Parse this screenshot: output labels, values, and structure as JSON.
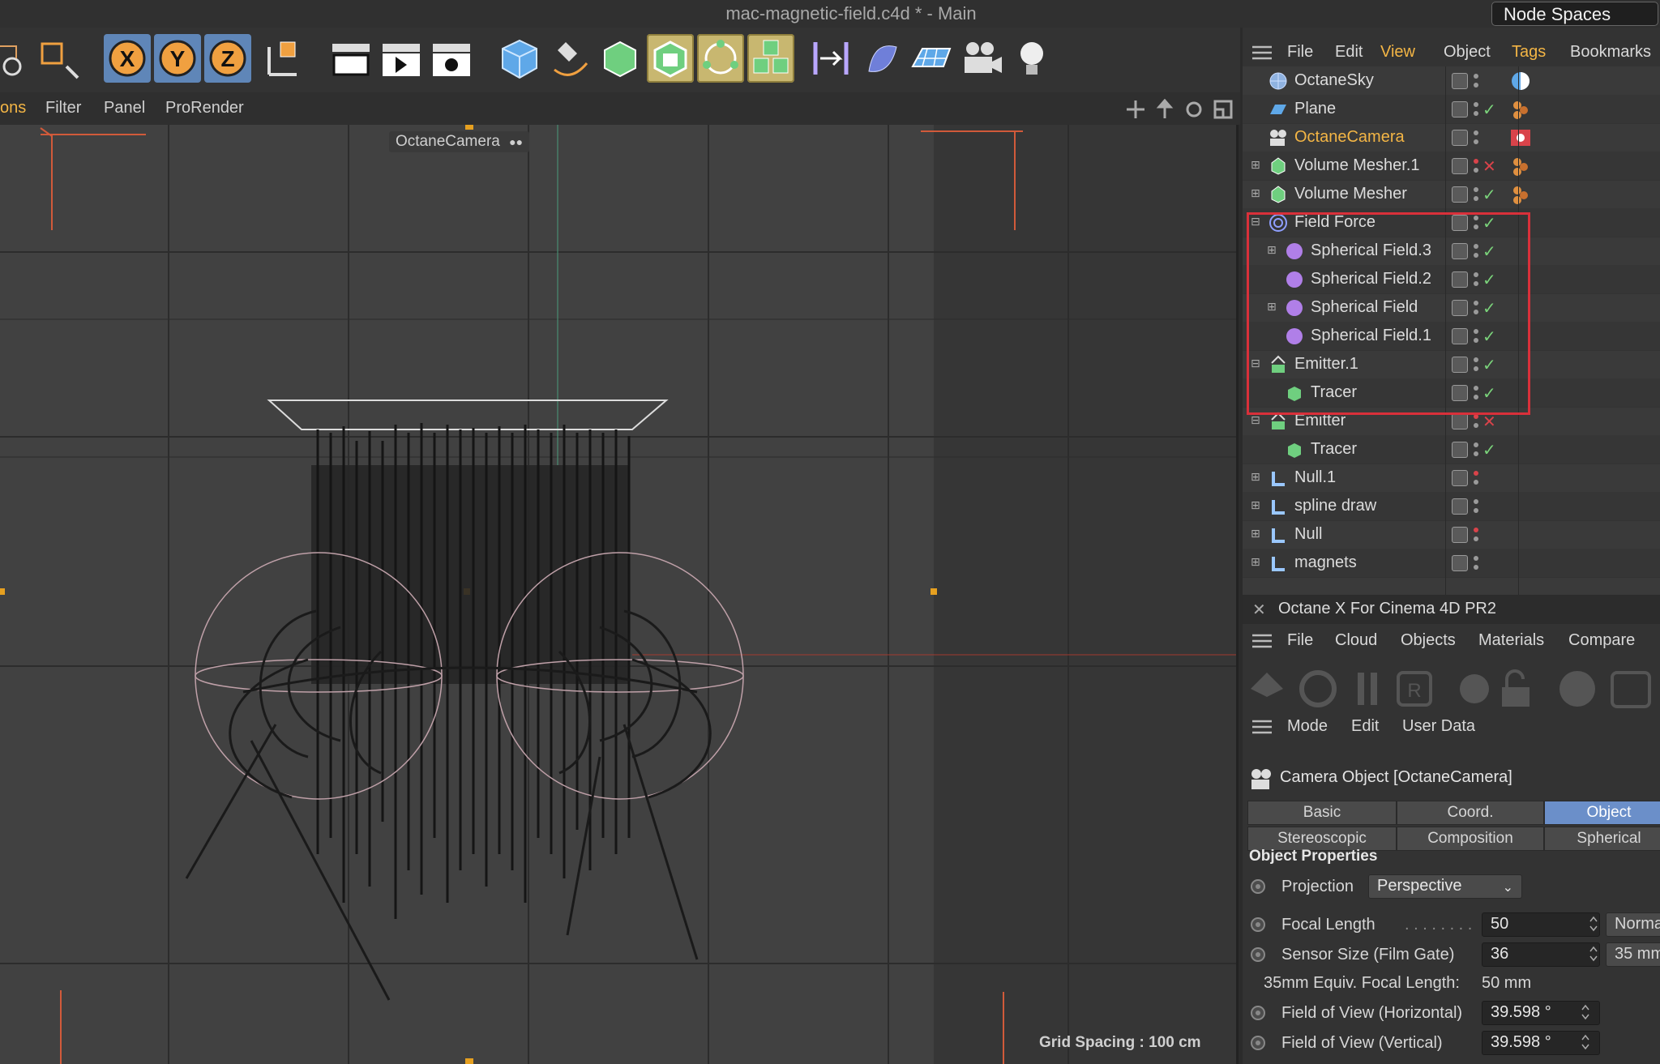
{
  "window": {
    "title": "mac-magnetic-field.c4d * - Main",
    "node_spaces": "Node Spaces"
  },
  "viewport": {
    "menu": [
      "ons",
      "Filter",
      "Panel",
      "ProRender"
    ],
    "camera_label": "OctaneCamera",
    "grid_spacing": "Grid Spacing : 100 cm"
  },
  "object_manager": {
    "menu": [
      "File",
      "Edit",
      "View",
      "Object",
      "Tags",
      "Bookmarks"
    ],
    "objects": [
      {
        "name": "OctaneSky",
        "icon": "sky-icon",
        "status": ""
      },
      {
        "name": "Plane",
        "icon": "plane-icon",
        "status": "check"
      },
      {
        "name": "OctaneCamera",
        "icon": "camera-icon",
        "status": "",
        "active": true
      },
      {
        "name": "Volume Mesher.1",
        "icon": "volume-mesher-icon",
        "status": "x"
      },
      {
        "name": "Volume Mesher",
        "icon": "volume-mesher-icon",
        "status": "check"
      },
      {
        "name": "Field Force",
        "icon": "field-force-icon",
        "status": "check"
      },
      {
        "name": "Spherical Field.3",
        "icon": "spherical-field-icon",
        "status": "check"
      },
      {
        "name": "Spherical Field.2",
        "icon": "spherical-field-icon",
        "status": "check"
      },
      {
        "name": "Spherical Field",
        "icon": "spherical-field-icon",
        "status": "check"
      },
      {
        "name": "Spherical Field.1",
        "icon": "spherical-field-icon",
        "status": "check"
      },
      {
        "name": "Emitter.1",
        "icon": "emitter-icon",
        "status": "check"
      },
      {
        "name": "Tracer",
        "icon": "tracer-icon",
        "status": "check"
      },
      {
        "name": "Emitter",
        "icon": "emitter-icon",
        "status": "x"
      },
      {
        "name": "Tracer",
        "icon": "tracer-icon",
        "status": "check"
      },
      {
        "name": "Null.1",
        "icon": "null-icon",
        "status": ""
      },
      {
        "name": "spline draw",
        "icon": "null-icon",
        "status": ""
      },
      {
        "name": "Null",
        "icon": "null-icon",
        "status": ""
      },
      {
        "name": "magnets",
        "icon": "null-icon",
        "status": ""
      }
    ]
  },
  "octane": {
    "title": "Octane X For Cinema 4D PR2",
    "menu": [
      "File",
      "Cloud",
      "Objects",
      "Materials",
      "Compare"
    ]
  },
  "attributes": {
    "menu": [
      "Mode",
      "Edit",
      "User Data"
    ],
    "title": "Camera Object [OctaneCamera]",
    "tabs_row1": [
      "Basic",
      "Coord.",
      "Object"
    ],
    "tabs_row2": [
      "Stereoscopic",
      "Composition",
      "Spherical"
    ],
    "section": "Object Properties",
    "projection_label": "Projection",
    "projection_value": "Perspective",
    "focal_length_label": "Focal Length",
    "focal_length_value": "50",
    "focal_length_extra": "Norma",
    "sensor_label": "Sensor Size (Film Gate)",
    "sensor_value": "36",
    "sensor_extra": "35 mm",
    "equiv_label": "35mm Equiv. Focal Length:",
    "equiv_value": "50 mm",
    "fov_h_label": "Field of View (Horizontal)",
    "fov_h_value": "39.598 °",
    "fov_v_label": "Field of View (Vertical)",
    "fov_v_value": "39.598 °"
  },
  "colors": {
    "accent": "#f3b545",
    "highlight": "#d9303a",
    "tab_active": "#6b8fc9",
    "check": "#7ad27a"
  }
}
